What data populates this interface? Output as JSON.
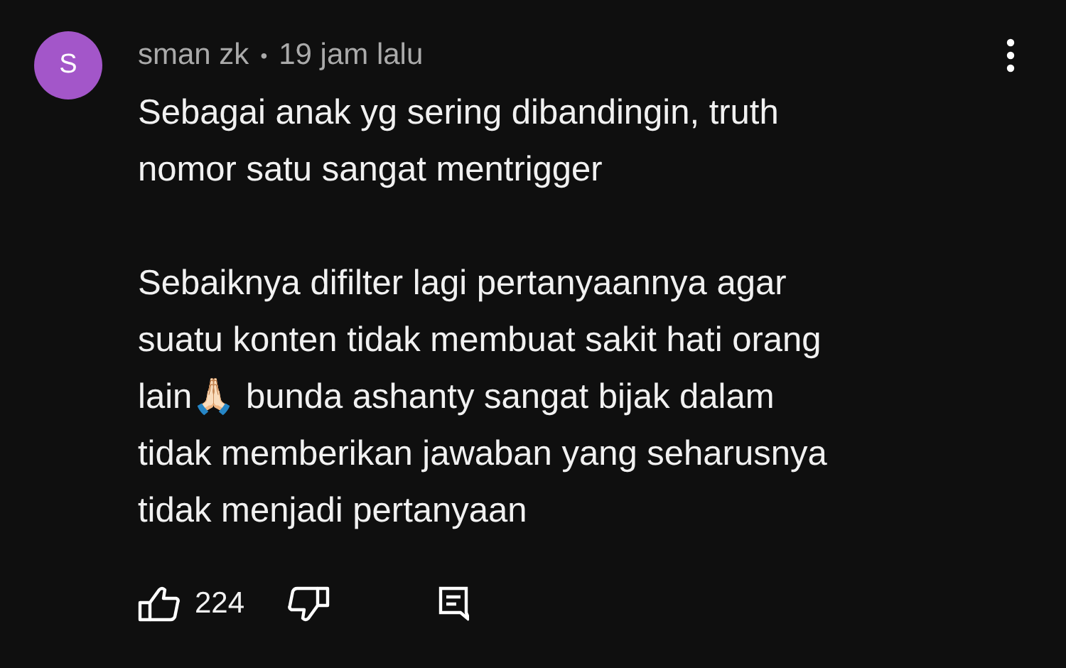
{
  "comment": {
    "avatar_letter": "S",
    "author": "sman zk",
    "separator": "•",
    "time": "19 jam lalu",
    "paragraphs": [
      [
        "Sebagai anak yg sering dibandingin, truth",
        "nomor satu sangat mentrigger"
      ],
      [
        "Sebaiknya difilter lagi pertanyaannya agar",
        "suatu konten tidak membuat sakit hati orang",
        "lain🙏🏻 bunda ashanty sangat bijak dalam",
        "tidak memberikan jawaban yang seharusnya",
        "tidak menjadi pertanyaan"
      ]
    ],
    "like_count": "224"
  }
}
